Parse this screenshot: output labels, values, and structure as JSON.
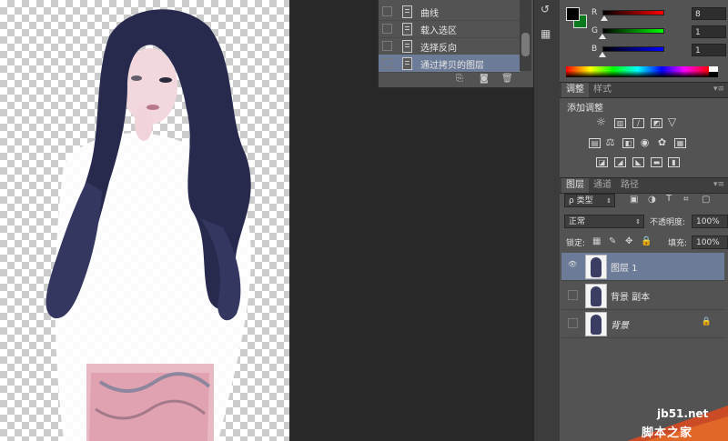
{
  "history": {
    "items": [
      {
        "label": "曲线",
        "selected": false
      },
      {
        "label": "载入选区",
        "selected": false
      },
      {
        "label": "选择反向",
        "selected": false
      },
      {
        "label": "通过拷贝的图层",
        "selected": true
      }
    ]
  },
  "color": {
    "foreground": "#000000",
    "background": "#0a7a1e",
    "channels": [
      {
        "label": "R",
        "value": "8",
        "fraction": 0.03,
        "gradient": "linear-gradient(to right,#000000,#ff0000)"
      },
      {
        "label": "G",
        "value": "1",
        "fraction": 0.0,
        "gradient": "linear-gradient(to right,#000000,#00ff00)"
      },
      {
        "label": "B",
        "value": "1",
        "fraction": 0.0,
        "gradient": "linear-gradient(to right,#000000,#0000ff)"
      }
    ]
  },
  "adjustments": {
    "tabs": [
      "调整",
      "样式"
    ],
    "heading": "添加调整"
  },
  "layers": {
    "tabs": [
      "图层",
      "通道",
      "路径"
    ],
    "filter_kind": "ρ 类型",
    "blend_mode": "正常",
    "opacity_label": "不透明度:",
    "opacity_value": "100%",
    "lock_label": "锁定:",
    "fill_label": "填充:",
    "fill_value": "100%",
    "items": [
      {
        "name": "图层 1",
        "visible": true,
        "selected": true,
        "locked": false,
        "italic": false
      },
      {
        "name": "背景 副本",
        "visible": false,
        "selected": false,
        "locked": false,
        "italic": false
      },
      {
        "name": "背景",
        "visible": false,
        "selected": false,
        "locked": true,
        "italic": true
      }
    ]
  },
  "watermark": {
    "site": "jb51.net",
    "name": "脚本之家"
  }
}
